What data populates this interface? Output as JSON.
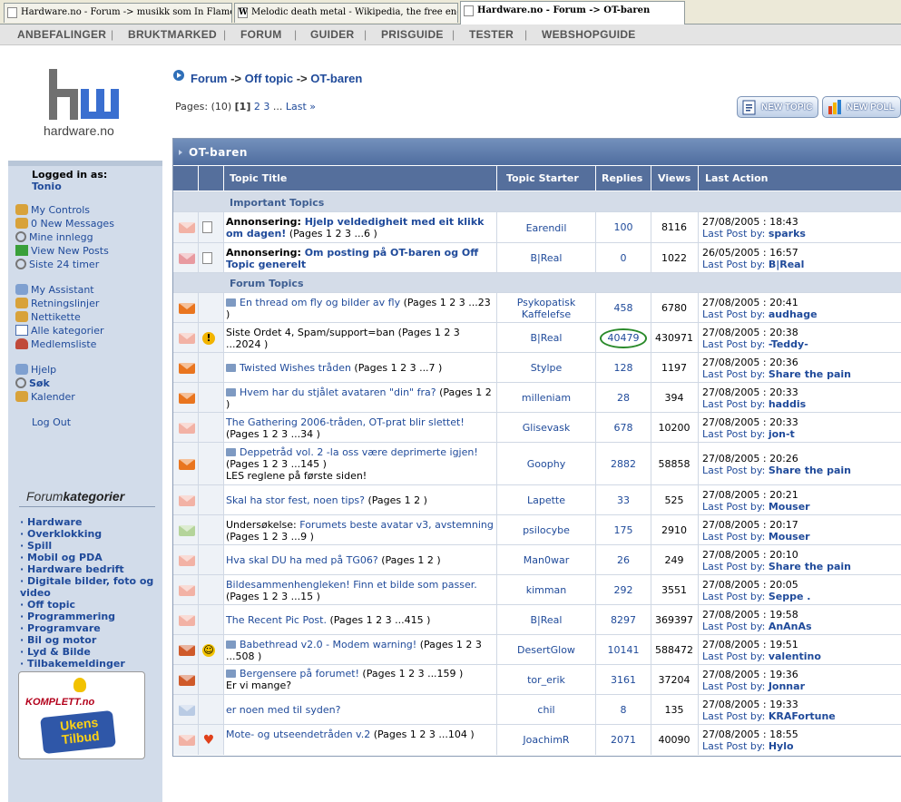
{
  "browser": {
    "tabs": [
      {
        "label": "Hardware.no - Forum -> musikk som In Flame..."
      },
      {
        "label": "Melodic death metal - Wikipedia, the free enc..."
      },
      {
        "label": "Hardware.no - Forum -> OT-baren"
      }
    ]
  },
  "topnav": {
    "items": [
      "ANBEFALINGER",
      "BRUKTMARKED",
      "FORUM",
      "GUIDER",
      "PRISGUIDE",
      "TESTER",
      "WEBSHOPGUIDE"
    ]
  },
  "sidebar": {
    "logo_text": "hardware.no",
    "logged_in_label": "Logged in as:",
    "username": "Tonio",
    "links": [
      "My Controls",
      "0 New Messages",
      "Mine innlegg",
      "View New Posts",
      "Siste 24 timer",
      "My Assistant",
      "Retningslinjer",
      "Nettikette",
      "Alle kategorier",
      "Medlemsliste",
      "Hjelp",
      "Søk",
      "Kalender",
      "Log Out"
    ],
    "categories_title_a": "Forum",
    "categories_title_b": "kategorier",
    "categories": [
      "· Hardware",
      "· Overklokking",
      "· Spill",
      "· Mobil og PDA",
      "· Hardware bedrift",
      "· Digitale bilder, foto og",
      "video",
      "· Off topic",
      "· Programmering",
      "· Programvare",
      "· Bil og motor",
      "· Lyd & Bilde",
      "· Tilbakemeldinger"
    ],
    "ad_brand": "KOMPLETT.no",
    "ad_line1": "Ukens",
    "ad_line2": "Tilbud"
  },
  "breadcrumb": {
    "forum": "Forum",
    "sep": "->",
    "offtopic": "Off topic",
    "current": "OT-baren"
  },
  "pages": {
    "label": "Pages: (10)",
    "current": "[1]",
    "p2": "2",
    "p3": "3",
    "dots": "...",
    "last": "Last »"
  },
  "buttons": {
    "new_topic": "NEW TOPIC",
    "new_poll": "NEW POLL"
  },
  "forum": {
    "title": "OT-baren",
    "columns": {
      "title": "Topic Title",
      "starter": "Topic Starter",
      "replies": "Replies",
      "views": "Views",
      "last": "Last Action"
    },
    "important_header": "Important Topics",
    "forum_header": "Forum Topics",
    "last_post_by": "Last Post by:",
    "important": [
      {
        "prefix": "Annonsering:",
        "title": "Hjelp veldedigheit med eit klikk om dagen!",
        "pages": "(Pages 1 2 3 ...6 )",
        "starter": "Earendil",
        "replies": "100",
        "views": "8116",
        "date": "27/08/2005 : 18:43",
        "by": "sparks"
      },
      {
        "prefix": "Annonsering:",
        "title": "Om posting på OT-baren og Off Topic generelt",
        "pages": "",
        "starter": "B|Real",
        "replies": "0",
        "views": "1022",
        "date": "26/05/2005 : 16:57",
        "by": "B|Real"
      }
    ],
    "topics": [
      {
        "title": "En thread om fly og bilder av fly",
        "pages": "(Pages 1 2 3 ...23 )",
        "starter": "Psykopatisk Kaffelefse",
        "replies": "458",
        "views": "6780",
        "date": "27/08/2005 : 20:41",
        "by": "audhage"
      },
      {
        "title": "Siste Ordet 4, Spam/support=ban",
        "pages": "(Pages 1 2 3 ...2024 )",
        "starter": "B|Real",
        "replies": "40479",
        "views": "430971",
        "date": "27/08/2005 : 20:38",
        "by": "-Teddy-"
      },
      {
        "title": "Twisted Wishes tråden",
        "pages": "(Pages 1 2 3 ...7 )",
        "starter": "Stylpe",
        "replies": "128",
        "views": "1197",
        "date": "27/08/2005 : 20:36",
        "by": "Share the pain"
      },
      {
        "title": "Hvem har du stjålet avataren \"din\" fra?",
        "pages": "(Pages 1 2 )",
        "starter": "milleniam",
        "replies": "28",
        "views": "394",
        "date": "27/08/2005 : 20:33",
        "by": "haddis"
      },
      {
        "title": "The Gathering 2006-tråden, OT-prat blir slettet!",
        "pages": "(Pages 1 2 3 ...34 )",
        "starter": "Glisevask",
        "replies": "678",
        "views": "10200",
        "date": "27/08/2005 : 20:33",
        "by": "jon-t"
      },
      {
        "title": "Deppetråd vol. 2 -la oss være deprimerte igjen!",
        "pages": "(Pages 1 2 3 ...145 )",
        "extra": "LES reglene på første siden!",
        "starter": "Goophy",
        "replies": "2882",
        "views": "58858",
        "date": "27/08/2005 : 20:26",
        "by": "Share the pain"
      },
      {
        "title": "Skal ha stor fest, noen tips?",
        "pages": "(Pages 1 2 )",
        "starter": "Lapette",
        "replies": "33",
        "views": "525",
        "date": "27/08/2005 : 20:21",
        "by": "Mouser"
      },
      {
        "prefix": "Undersøkelse:",
        "title": "Forumets beste avatar v3, avstemning",
        "pages": "(Pages 1 2 3 ...9 )",
        "starter": "psilocybe",
        "replies": "175",
        "views": "2910",
        "date": "27/08/2005 : 20:17",
        "by": "Mouser"
      },
      {
        "title": "Hva skal DU ha med på TG06?",
        "pages": "(Pages 1 2 )",
        "starter": "Man0war",
        "replies": "26",
        "views": "249",
        "date": "27/08/2005 : 20:10",
        "by": "Share the pain"
      },
      {
        "title": "Bildesammenhengleken! Finn et bilde som passer.",
        "pages": "(Pages 1 2 3 ...15 )",
        "starter": "kimman",
        "replies": "292",
        "views": "3551",
        "date": "27/08/2005 : 20:05",
        "by": "Seppe ."
      },
      {
        "title": "The Recent Pic Post.",
        "pages": "(Pages 1 2 3 ...415 )",
        "starter": "B|Real",
        "replies": "8297",
        "views": "369397",
        "date": "27/08/2005 : 19:58",
        "by": "AnAnAs"
      },
      {
        "title": "Babethread v2.0 - Modem warning!",
        "pages": "(Pages 1 2 3 ...508 )",
        "starter": "DesertGlow",
        "replies": "10141",
        "views": "588472",
        "date": "27/08/2005 : 19:51",
        "by": "valentino"
      },
      {
        "title": "Bergensere på forumet!",
        "pages": "(Pages 1 2 3 ...159 )",
        "extra": "Er vi mange?",
        "starter": "tor_erik",
        "replies": "3161",
        "views": "37204",
        "date": "27/08/2005 : 19:36",
        "by": "Jonnar"
      },
      {
        "title": "er noen med til syden?",
        "pages": "",
        "starter": "chil",
        "replies": "8",
        "views": "135",
        "date": "27/08/2005 : 19:33",
        "by": "KRAFortune"
      },
      {
        "title": "Mote- og utseendetråden v.2",
        "pages": "(Pages 1 2 3 ...104 )",
        "starter": "JoachimR",
        "replies": "2071",
        "views": "40090",
        "date": "27/08/2005 : 18:55",
        "by": "Hylo"
      }
    ]
  },
  "colors": {
    "accent": "#1f4a9a",
    "header": "#556f9c",
    "sidebar": "#d2dcea",
    "highlight_circle": "#2a8a2a"
  },
  "icons": {
    "envelope": "envelope-icon",
    "warning": "warning-icon",
    "heart": "heart-icon",
    "smiley": "sunglasses-smiley-icon",
    "document": "document-icon"
  }
}
